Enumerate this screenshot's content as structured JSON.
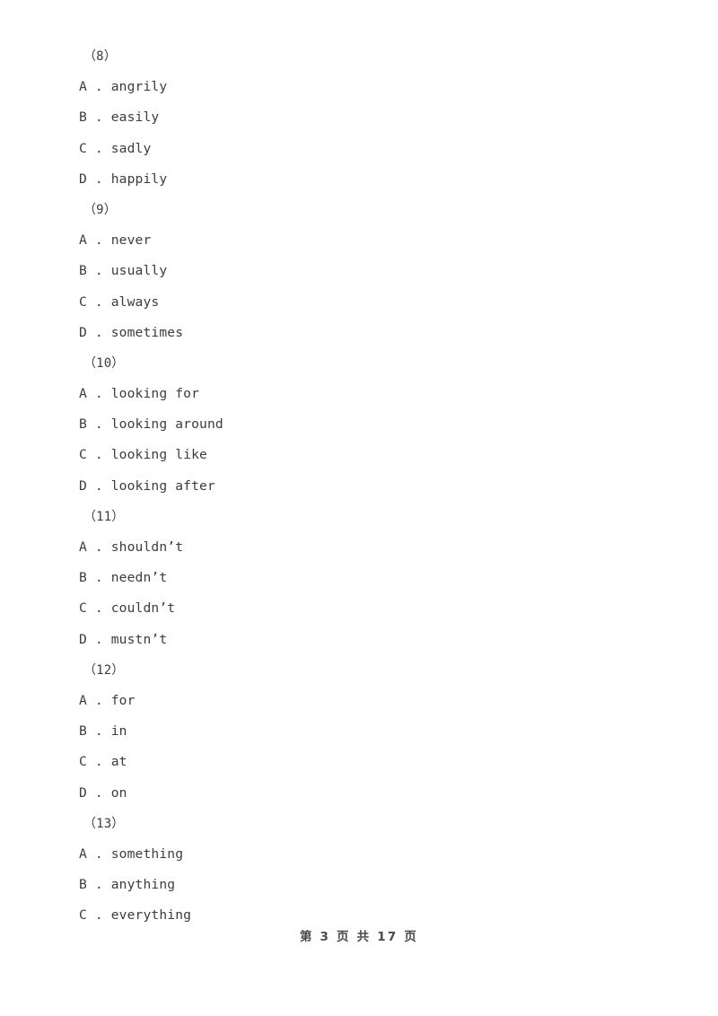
{
  "document": {
    "background_color": "#ffffff",
    "text_color": "#3c3c3c",
    "blocks": [
      {
        "number": "（8）",
        "options": [
          {
            "letter": "A",
            "sep": " . ",
            "text": "angrily"
          },
          {
            "letter": "B",
            "sep": " . ",
            "text": "easily"
          },
          {
            "letter": "C",
            "sep": " . ",
            "text": "sadly"
          },
          {
            "letter": "D",
            "sep": " . ",
            "text": "happily"
          }
        ]
      },
      {
        "number": "（9）",
        "options": [
          {
            "letter": "A",
            "sep": " . ",
            "text": "never"
          },
          {
            "letter": "B",
            "sep": " . ",
            "text": "usually"
          },
          {
            "letter": "C",
            "sep": " . ",
            "text": "always"
          },
          {
            "letter": "D",
            "sep": " . ",
            "text": "sometimes"
          }
        ]
      },
      {
        "number": "（10）",
        "options": [
          {
            "letter": "A",
            "sep": " . ",
            "text": "looking for"
          },
          {
            "letter": "B",
            "sep": " . ",
            "text": "looking around"
          },
          {
            "letter": "C",
            "sep": " . ",
            "text": "looking like"
          },
          {
            "letter": "D",
            "sep": " . ",
            "text": "looking after"
          }
        ]
      },
      {
        "number": "（11）",
        "options": [
          {
            "letter": "A",
            "sep": " . ",
            "text": "shouldn’t"
          },
          {
            "letter": "B",
            "sep": " . ",
            "text": "needn’t"
          },
          {
            "letter": "C",
            "sep": " . ",
            "text": "couldn’t"
          },
          {
            "letter": "D",
            "sep": " . ",
            "text": "mustn’t"
          }
        ]
      },
      {
        "number": "（12）",
        "options": [
          {
            "letter": "A",
            "sep": " . ",
            "text": "for"
          },
          {
            "letter": "B",
            "sep": " . ",
            "text": "in"
          },
          {
            "letter": "C",
            "sep": " . ",
            "text": "at"
          },
          {
            "letter": "D",
            "sep": " . ",
            "text": "on"
          }
        ]
      },
      {
        "number": "（13）",
        "options": [
          {
            "letter": "A",
            "sep": " . ",
            "text": "something"
          },
          {
            "letter": "B",
            "sep": " . ",
            "text": "anything"
          },
          {
            "letter": "C",
            "sep": " . ",
            "text": "everything"
          }
        ]
      }
    ]
  },
  "footer": {
    "text": "第 3 页 共 17 页",
    "page_number": "3",
    "total_pages": "17"
  }
}
